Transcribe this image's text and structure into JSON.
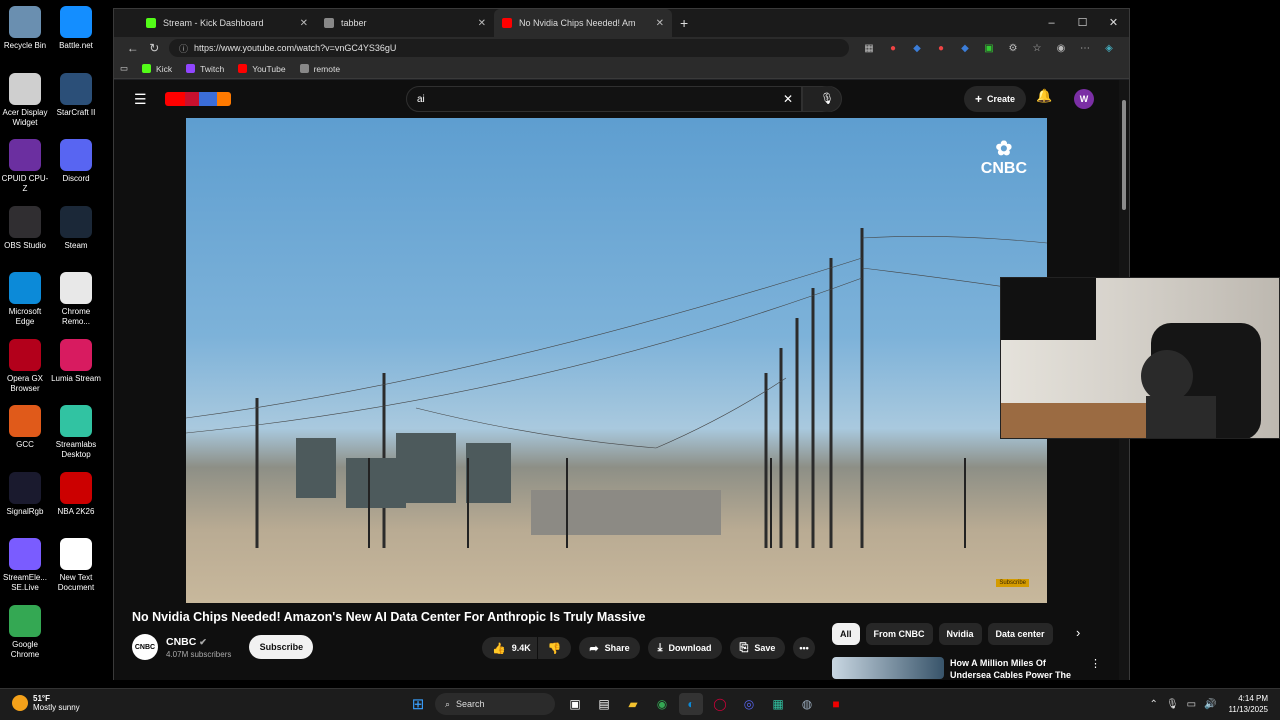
{
  "desktop": {
    "icons": [
      {
        "label": "Recycle Bin",
        "color": "#6a8fb0"
      },
      {
        "label": "Battle.net",
        "color": "#148eff"
      },
      {
        "label": "Acer Display Widget",
        "color": "#cfcfcf"
      },
      {
        "label": "StarCraft II",
        "color": "#2b4f78"
      },
      {
        "label": "CPUID CPU-Z",
        "color": "#6b2fa0"
      },
      {
        "label": "Discord",
        "color": "#5865f2"
      },
      {
        "label": "OBS Studio",
        "color": "#302e31"
      },
      {
        "label": "Steam",
        "color": "#1b2838"
      },
      {
        "label": "Microsoft Edge",
        "color": "#0c8ad8"
      },
      {
        "label": "Chrome Remo...",
        "color": "#e8e8e8"
      },
      {
        "label": "Opera GX Browser",
        "color": "#b3001b"
      },
      {
        "label": "Lumia Stream",
        "color": "#d81b60"
      },
      {
        "label": "GCC",
        "color": "#e05a1a"
      },
      {
        "label": "Streamlabs Desktop",
        "color": "#31c3a2"
      },
      {
        "label": "SignalRgb",
        "color": "#1a1a2e"
      },
      {
        "label": "NBA 2K26",
        "color": "#cc0000"
      },
      {
        "label": "StreamEle... SE.Live",
        "color": "#7a5cff"
      },
      {
        "label": "New Text Document",
        "color": "#ffffff"
      },
      {
        "label": "Google Chrome",
        "color": "#34a853"
      }
    ]
  },
  "browser": {
    "tabs": [
      {
        "label": "Stream - Kick Dashboard",
        "favicon_color": "#53fc18",
        "active": false
      },
      {
        "label": "tabber",
        "favicon_color": "#888888",
        "active": false
      },
      {
        "label": "No Nvidia Chips Needed! Am",
        "favicon_color": "#ff0000",
        "active": true
      }
    ],
    "new_tab": "+",
    "url": "https://www.youtube.com/watch?v=vnGC4YS36gU",
    "bookmarks": [
      {
        "label": "Kick",
        "color": "#53fc18"
      },
      {
        "label": "Twitch",
        "color": "#9146ff"
      },
      {
        "label": "YouTube",
        "color": "#ff0000"
      },
      {
        "label": "remote",
        "color": "#888888"
      }
    ]
  },
  "youtube": {
    "search_query": "ai",
    "create_label": "Create",
    "avatar_letter": "W",
    "video": {
      "watermark": "CNBC",
      "subscribe_watermark": "Subscribe",
      "title": "No Nvidia Chips Needed! Amazon's New AI Data Center For Anthropic Is Truly Massive"
    },
    "channel": {
      "name": "CNBC",
      "subscribers": "4.07M subscribers",
      "avatar_text": "CNBC",
      "subscribe_label": "Subscribe"
    },
    "actions": {
      "likes": "9.4K",
      "share": "Share",
      "download": "Download",
      "save": "Save"
    },
    "chips": [
      "All",
      "From CNBC",
      "Nvidia",
      "Data center"
    ],
    "related": {
      "title": "How A Million Miles Of Undersea Cables Power The"
    }
  },
  "taskbar": {
    "temperature": "51°F",
    "condition": "Mostly sunny",
    "search_placeholder": "Search",
    "time": "4:14 PM",
    "date": "11/13/2025"
  }
}
